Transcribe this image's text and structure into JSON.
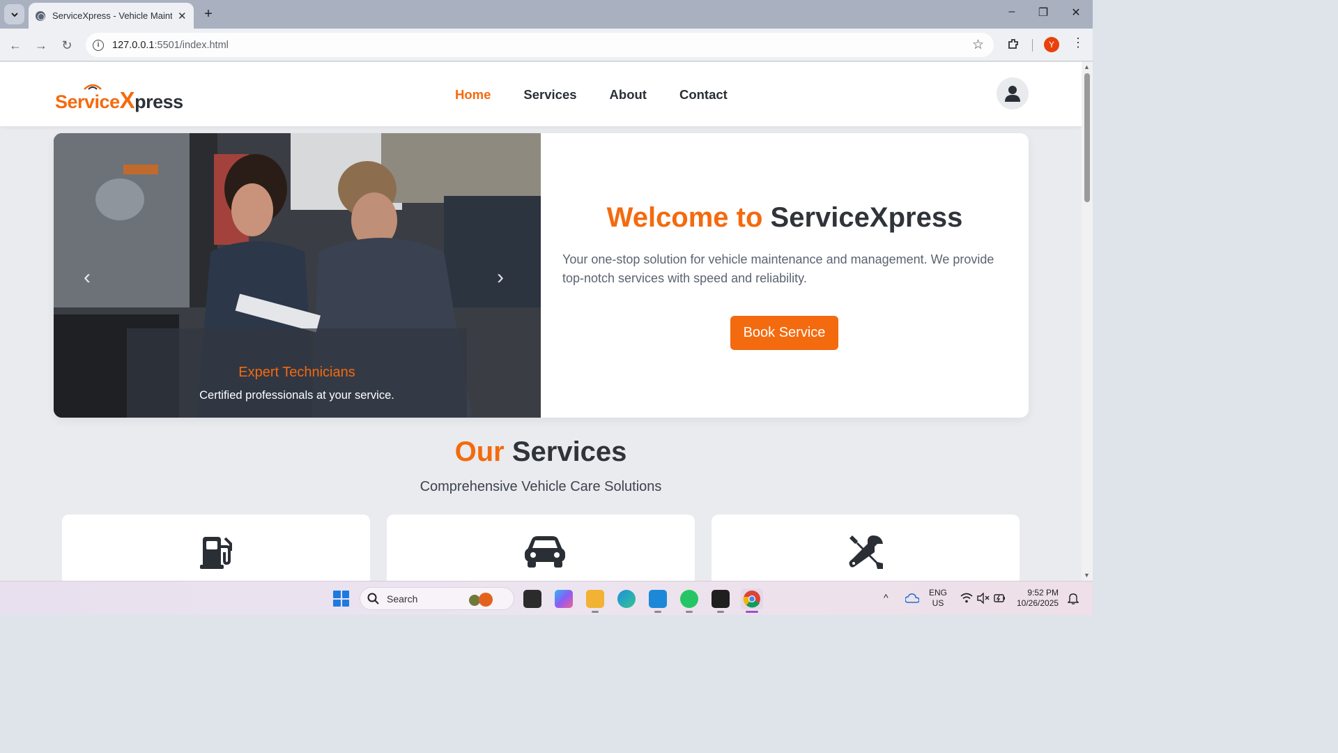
{
  "browser": {
    "tab_title": "ServiceXpress - Vehicle Maintenance",
    "url_host": "127.0.0.1",
    "url_rest": ":5501/index.html",
    "profile_initial": "Y"
  },
  "site": {
    "logo_part1": "Service",
    "logo_part2": "X",
    "logo_part3": "press",
    "nav": [
      "Home",
      "Services",
      "About",
      "Contact"
    ],
    "active_nav": "Home"
  },
  "hero": {
    "caption_title": "Expert Technicians",
    "caption_subtitle": "Certified professionals at your service.",
    "title_accent": "Welcome to",
    "title_main": "ServiceXpress",
    "description": "Your one-stop solution for vehicle maintenance and management. We provide top-notch services with speed and reliability.",
    "cta": "Book Service"
  },
  "services": {
    "heading_accent": "Our",
    "heading_main": "Services",
    "subtitle": "Comprehensive Vehicle Care Solutions",
    "cards": [
      {
        "icon": "fuel-pump-icon"
      },
      {
        "icon": "car-icon"
      },
      {
        "icon": "tools-icon"
      }
    ]
  },
  "taskbar": {
    "search_label": "Search",
    "lang_line1": "ENG",
    "lang_line2": "US",
    "time": "9:52 PM",
    "date": "10/26/2025"
  },
  "colors": {
    "accent": "#f46a0e",
    "dark_text": "#2f343a"
  }
}
